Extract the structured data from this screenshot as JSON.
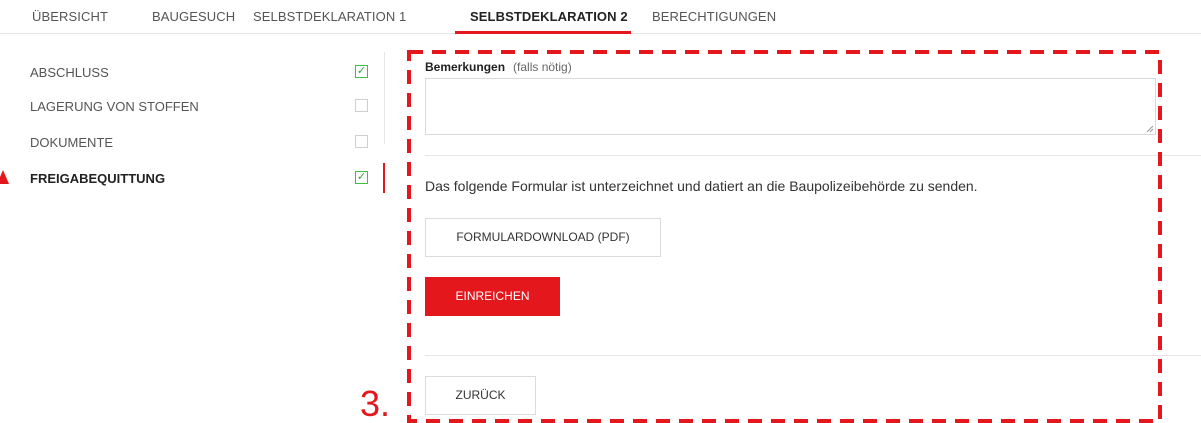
{
  "tabs": [
    {
      "label": "ÜBERSICHT"
    },
    {
      "label": "BAUGESUCH"
    },
    {
      "label": "SELBSTDEKLARATION 1"
    },
    {
      "label": "SELBSTDEKLARATION 2"
    },
    {
      "label": "BERECHTIGUNGEN"
    }
  ],
  "active_tab": "SELBSTDEKLARATION 2",
  "sidebar": {
    "items": [
      {
        "label": "ABSCHLUSS",
        "checked": true
      },
      {
        "label": "LAGERUNG VON STOFFEN",
        "checked": false
      },
      {
        "label": "DOKUMENTE",
        "checked": false
      },
      {
        "label": "FREIGABEQUITTUNG",
        "checked": true
      }
    ],
    "active_item": "FREIGABEQUITTUNG",
    "checkmark": "✓"
  },
  "form": {
    "remarks_label": "Bemerkungen",
    "remarks_hint": "(falls nötig)",
    "remarks_value": "",
    "info_text": "Das folgende Formular ist unterzeichnet und datiert an die Baupolizeibehörde zu senden.",
    "download_label": "FORMULARDOWNLOAD (PDF)",
    "submit_label": "EINREICHEN",
    "back_label": "ZURÜCK"
  },
  "annotation": {
    "step_number": "3."
  },
  "colors": {
    "accent": "#e3171c",
    "check": "#3fbf3f",
    "text": "#333333",
    "border": "#dcdcdc"
  }
}
